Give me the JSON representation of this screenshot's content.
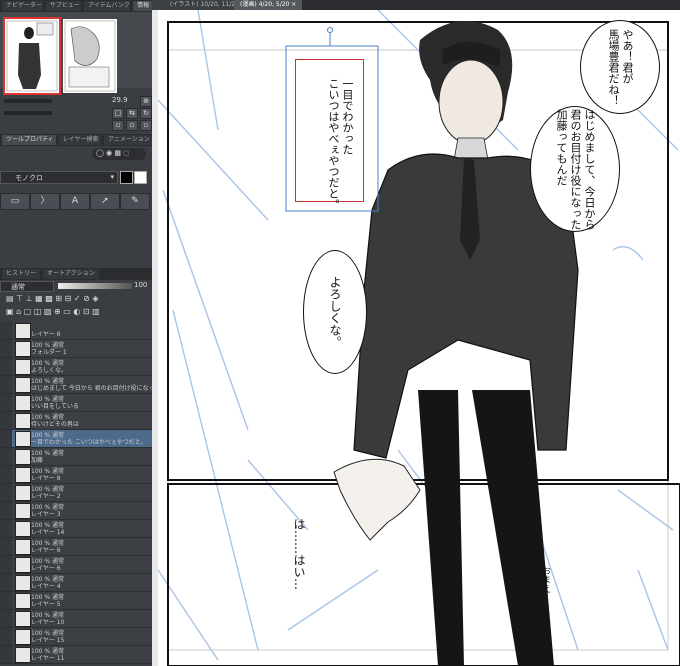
{
  "left_panel": {
    "top_tabs": [
      "ナビゲーター",
      "サブビュー",
      "アイテムバンク",
      "情報"
    ],
    "brush_size": "29.9",
    "property_tabs": [
      "ツールプロパティ",
      "レイヤー検索",
      "アニメーション"
    ],
    "color_mode": "モノクロ",
    "layer_tabs": [
      "ヒストリー",
      "オートアクション"
    ],
    "blend_mode": "通常",
    "opacity": "100",
    "layers": [
      {
        "num": "",
        "name": "レイヤー 6"
      },
      {
        "num": "100 % 通常",
        "name": "フォルダー 1"
      },
      {
        "num": "100 % 通常",
        "name": "よろしくな。"
      },
      {
        "num": "100 % 通常",
        "name": "はじめまして 今日から 君のお目付け役になった 加藤っ"
      },
      {
        "num": "100 % 通常",
        "name": "いい目をしている"
      },
      {
        "num": "100 % 通常",
        "name": "待いけどその男は"
      },
      {
        "num": "100 % 通常",
        "name": "一目でわかった こいつはやべぇやつだと。"
      },
      {
        "num": "100 % 通常",
        "name": "加藤"
      },
      {
        "num": "100 % 通常",
        "name": "レイヤー 8"
      },
      {
        "num": "100 % 通常",
        "name": "レイヤー 2"
      },
      {
        "num": "100 % 通常",
        "name": "レイヤー 3"
      },
      {
        "num": "100 % 通常",
        "name": "レイヤー 14"
      },
      {
        "num": "100 % 通常",
        "name": "レイヤー 6"
      },
      {
        "num": "100 % 通常",
        "name": "レイヤー 6"
      },
      {
        "num": "100 % 通常",
        "name": "レイヤー 4"
      },
      {
        "num": "100 % 通常",
        "name": "レイヤー 5"
      },
      {
        "num": "100 % 通常",
        "name": "レイヤー 10"
      },
      {
        "num": "100 % 通常",
        "name": "レイヤー 15"
      },
      {
        "num": "100 % 通常",
        "name": "レイヤー 11"
      }
    ],
    "bottom_status": "35.9"
  },
  "canvas": {
    "tabs": [
      {
        "label": "(イラスト) 10/20, 11/20 ×"
      },
      {
        "label": "(漫画) 4/20, 5/20 ×"
      }
    ],
    "bubbles": [
      {
        "text": "やあ！君が\n馬場豊君だね！"
      },
      {
        "text": "はじめまして、今日から\n君のお目付け役になった\n加藤ってもんだ"
      },
      {
        "text": "よろしくな。"
      }
    ],
    "caption_box": "一目でわかった\nこいつはやべぇやつだと。",
    "bottom_text": "は……はい…",
    "side_text": "おまえ"
  }
}
